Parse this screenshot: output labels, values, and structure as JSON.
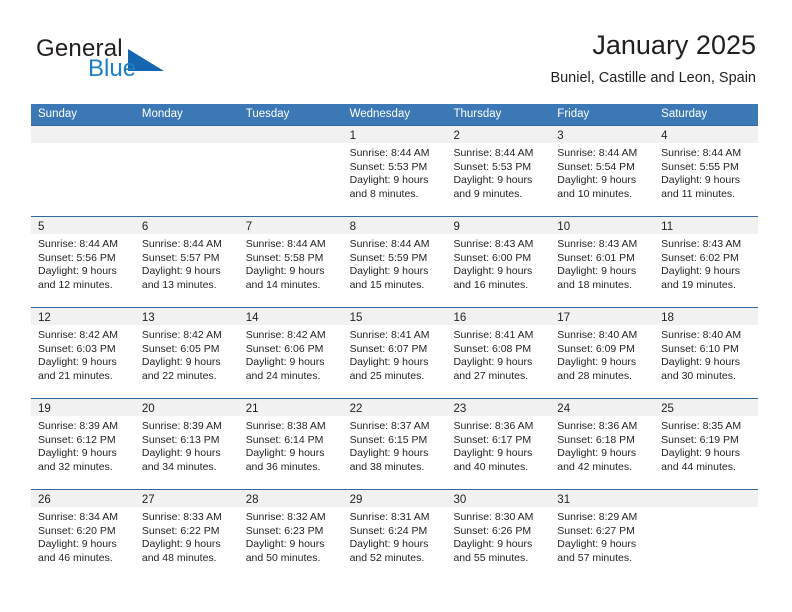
{
  "brand": {
    "name_part1": "General",
    "name_part2": "Blue",
    "logo_icon": "blue-triangle-logo-icon"
  },
  "header": {
    "title": "January 2025",
    "subtitle": "Buniel, Castille and Leon, Spain"
  },
  "colors": {
    "header_blue": "#3b78b5",
    "row_rule_blue": "#31689f",
    "day_band_gray": "#f1f1f1",
    "logo_blue": "#1d7fc4",
    "text": "#231f20"
  },
  "weekdays": [
    "Sunday",
    "Monday",
    "Tuesday",
    "Wednesday",
    "Thursday",
    "Friday",
    "Saturday"
  ],
  "weeks": [
    [
      {
        "day": "",
        "empty": true,
        "sunrise": "",
        "sunset": "",
        "daylight1": "",
        "daylight2": ""
      },
      {
        "day": "",
        "empty": true,
        "sunrise": "",
        "sunset": "",
        "daylight1": "",
        "daylight2": ""
      },
      {
        "day": "",
        "empty": true,
        "sunrise": "",
        "sunset": "",
        "daylight1": "",
        "daylight2": ""
      },
      {
        "day": "1",
        "empty": false,
        "sunrise": "Sunrise: 8:44 AM",
        "sunset": "Sunset: 5:53 PM",
        "daylight1": "Daylight: 9 hours",
        "daylight2": "and 8 minutes."
      },
      {
        "day": "2",
        "empty": false,
        "sunrise": "Sunrise: 8:44 AM",
        "sunset": "Sunset: 5:53 PM",
        "daylight1": "Daylight: 9 hours",
        "daylight2": "and 9 minutes."
      },
      {
        "day": "3",
        "empty": false,
        "sunrise": "Sunrise: 8:44 AM",
        "sunset": "Sunset: 5:54 PM",
        "daylight1": "Daylight: 9 hours",
        "daylight2": "and 10 minutes."
      },
      {
        "day": "4",
        "empty": false,
        "sunrise": "Sunrise: 8:44 AM",
        "sunset": "Sunset: 5:55 PM",
        "daylight1": "Daylight: 9 hours",
        "daylight2": "and 11 minutes."
      }
    ],
    [
      {
        "day": "5",
        "empty": false,
        "sunrise": "Sunrise: 8:44 AM",
        "sunset": "Sunset: 5:56 PM",
        "daylight1": "Daylight: 9 hours",
        "daylight2": "and 12 minutes."
      },
      {
        "day": "6",
        "empty": false,
        "sunrise": "Sunrise: 8:44 AM",
        "sunset": "Sunset: 5:57 PM",
        "daylight1": "Daylight: 9 hours",
        "daylight2": "and 13 minutes."
      },
      {
        "day": "7",
        "empty": false,
        "sunrise": "Sunrise: 8:44 AM",
        "sunset": "Sunset: 5:58 PM",
        "daylight1": "Daylight: 9 hours",
        "daylight2": "and 14 minutes."
      },
      {
        "day": "8",
        "empty": false,
        "sunrise": "Sunrise: 8:44 AM",
        "sunset": "Sunset: 5:59 PM",
        "daylight1": "Daylight: 9 hours",
        "daylight2": "and 15 minutes."
      },
      {
        "day": "9",
        "empty": false,
        "sunrise": "Sunrise: 8:43 AM",
        "sunset": "Sunset: 6:00 PM",
        "daylight1": "Daylight: 9 hours",
        "daylight2": "and 16 minutes."
      },
      {
        "day": "10",
        "empty": false,
        "sunrise": "Sunrise: 8:43 AM",
        "sunset": "Sunset: 6:01 PM",
        "daylight1": "Daylight: 9 hours",
        "daylight2": "and 18 minutes."
      },
      {
        "day": "11",
        "empty": false,
        "sunrise": "Sunrise: 8:43 AM",
        "sunset": "Sunset: 6:02 PM",
        "daylight1": "Daylight: 9 hours",
        "daylight2": "and 19 minutes."
      }
    ],
    [
      {
        "day": "12",
        "empty": false,
        "sunrise": "Sunrise: 8:42 AM",
        "sunset": "Sunset: 6:03 PM",
        "daylight1": "Daylight: 9 hours",
        "daylight2": "and 21 minutes."
      },
      {
        "day": "13",
        "empty": false,
        "sunrise": "Sunrise: 8:42 AM",
        "sunset": "Sunset: 6:05 PM",
        "daylight1": "Daylight: 9 hours",
        "daylight2": "and 22 minutes."
      },
      {
        "day": "14",
        "empty": false,
        "sunrise": "Sunrise: 8:42 AM",
        "sunset": "Sunset: 6:06 PM",
        "daylight1": "Daylight: 9 hours",
        "daylight2": "and 24 minutes."
      },
      {
        "day": "15",
        "empty": false,
        "sunrise": "Sunrise: 8:41 AM",
        "sunset": "Sunset: 6:07 PM",
        "daylight1": "Daylight: 9 hours",
        "daylight2": "and 25 minutes."
      },
      {
        "day": "16",
        "empty": false,
        "sunrise": "Sunrise: 8:41 AM",
        "sunset": "Sunset: 6:08 PM",
        "daylight1": "Daylight: 9 hours",
        "daylight2": "and 27 minutes."
      },
      {
        "day": "17",
        "empty": false,
        "sunrise": "Sunrise: 8:40 AM",
        "sunset": "Sunset: 6:09 PM",
        "daylight1": "Daylight: 9 hours",
        "daylight2": "and 28 minutes."
      },
      {
        "day": "18",
        "empty": false,
        "sunrise": "Sunrise: 8:40 AM",
        "sunset": "Sunset: 6:10 PM",
        "daylight1": "Daylight: 9 hours",
        "daylight2": "and 30 minutes."
      }
    ],
    [
      {
        "day": "19",
        "empty": false,
        "sunrise": "Sunrise: 8:39 AM",
        "sunset": "Sunset: 6:12 PM",
        "daylight1": "Daylight: 9 hours",
        "daylight2": "and 32 minutes."
      },
      {
        "day": "20",
        "empty": false,
        "sunrise": "Sunrise: 8:39 AM",
        "sunset": "Sunset: 6:13 PM",
        "daylight1": "Daylight: 9 hours",
        "daylight2": "and 34 minutes."
      },
      {
        "day": "21",
        "empty": false,
        "sunrise": "Sunrise: 8:38 AM",
        "sunset": "Sunset: 6:14 PM",
        "daylight1": "Daylight: 9 hours",
        "daylight2": "and 36 minutes."
      },
      {
        "day": "22",
        "empty": false,
        "sunrise": "Sunrise: 8:37 AM",
        "sunset": "Sunset: 6:15 PM",
        "daylight1": "Daylight: 9 hours",
        "daylight2": "and 38 minutes."
      },
      {
        "day": "23",
        "empty": false,
        "sunrise": "Sunrise: 8:36 AM",
        "sunset": "Sunset: 6:17 PM",
        "daylight1": "Daylight: 9 hours",
        "daylight2": "and 40 minutes."
      },
      {
        "day": "24",
        "empty": false,
        "sunrise": "Sunrise: 8:36 AM",
        "sunset": "Sunset: 6:18 PM",
        "daylight1": "Daylight: 9 hours",
        "daylight2": "and 42 minutes."
      },
      {
        "day": "25",
        "empty": false,
        "sunrise": "Sunrise: 8:35 AM",
        "sunset": "Sunset: 6:19 PM",
        "daylight1": "Daylight: 9 hours",
        "daylight2": "and 44 minutes."
      }
    ],
    [
      {
        "day": "26",
        "empty": false,
        "sunrise": "Sunrise: 8:34 AM",
        "sunset": "Sunset: 6:20 PM",
        "daylight1": "Daylight: 9 hours",
        "daylight2": "and 46 minutes."
      },
      {
        "day": "27",
        "empty": false,
        "sunrise": "Sunrise: 8:33 AM",
        "sunset": "Sunset: 6:22 PM",
        "daylight1": "Daylight: 9 hours",
        "daylight2": "and 48 minutes."
      },
      {
        "day": "28",
        "empty": false,
        "sunrise": "Sunrise: 8:32 AM",
        "sunset": "Sunset: 6:23 PM",
        "daylight1": "Daylight: 9 hours",
        "daylight2": "and 50 minutes."
      },
      {
        "day": "29",
        "empty": false,
        "sunrise": "Sunrise: 8:31 AM",
        "sunset": "Sunset: 6:24 PM",
        "daylight1": "Daylight: 9 hours",
        "daylight2": "and 52 minutes."
      },
      {
        "day": "30",
        "empty": false,
        "sunrise": "Sunrise: 8:30 AM",
        "sunset": "Sunset: 6:26 PM",
        "daylight1": "Daylight: 9 hours",
        "daylight2": "and 55 minutes."
      },
      {
        "day": "31",
        "empty": false,
        "sunrise": "Sunrise: 8:29 AM",
        "sunset": "Sunset: 6:27 PM",
        "daylight1": "Daylight: 9 hours",
        "daylight2": "and 57 minutes."
      },
      {
        "day": "",
        "empty": true,
        "sunrise": "",
        "sunset": "",
        "daylight1": "",
        "daylight2": ""
      }
    ]
  ]
}
